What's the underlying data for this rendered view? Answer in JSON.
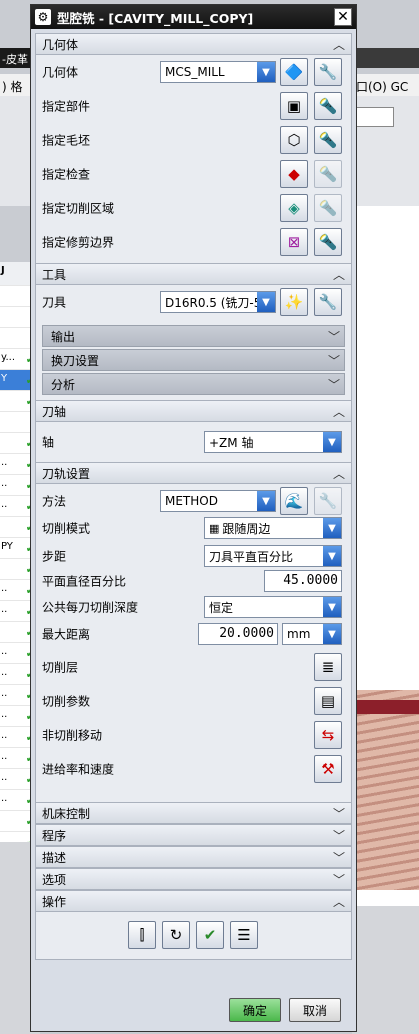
{
  "background": {
    "title_fragment": "-皮革",
    "menu_left": ") 格",
    "menu_right": "口(O)  GC",
    "nav_rows": [
      {
        "text": "",
        "check": false,
        "selected": false
      },
      {
        "text": "",
        "check": false,
        "selected": false
      },
      {
        "text": "",
        "check": false,
        "selected": false
      },
      {
        "text": "y...",
        "check": true,
        "selected": false
      },
      {
        "text": "Y",
        "check": true,
        "selected": true
      },
      {
        "text": "",
        "check": true,
        "selected": false
      },
      {
        "text": "",
        "check": false,
        "selected": false
      },
      {
        "text": "",
        "check": true,
        "selected": false
      },
      {
        "text": "..",
        "check": true,
        "selected": false
      },
      {
        "text": "..",
        "check": true,
        "selected": false
      },
      {
        "text": "..",
        "check": true,
        "selected": false
      },
      {
        "text": "",
        "check": true,
        "selected": false
      },
      {
        "text": "PY",
        "check": true,
        "selected": false
      },
      {
        "text": "",
        "check": true,
        "selected": false
      },
      {
        "text": "..",
        "check": true,
        "selected": false
      },
      {
        "text": "..",
        "check": true,
        "selected": false
      },
      {
        "text": "",
        "check": true,
        "selected": false
      },
      {
        "text": "..",
        "check": true,
        "selected": false
      },
      {
        "text": "..",
        "check": true,
        "selected": false
      },
      {
        "text": "..",
        "check": true,
        "selected": false
      },
      {
        "text": "..",
        "check": true,
        "selected": false
      },
      {
        "text": "..",
        "check": true,
        "selected": false
      },
      {
        "text": "..",
        "check": true,
        "selected": false
      },
      {
        "text": "..",
        "check": true,
        "selected": false
      },
      {
        "text": "..",
        "check": true,
        "selected": false
      },
      {
        "text": "",
        "check": true,
        "selected": false
      },
      {
        "text": "",
        "check": true,
        "selected": false
      }
    ],
    "header_col": "J"
  },
  "dialog": {
    "title": "型腔铣 - [CAVITY_MILL_COPY]",
    "gear_icon": "gear-icon",
    "close_icon": "close-icon"
  },
  "geometry": {
    "header": "几何体",
    "geometry_label": "几何体",
    "geometry_value": "MCS_MILL",
    "part_label": "指定部件",
    "blank_label": "指定毛坯",
    "check_label": "指定检查",
    "cut_area_label": "指定切削区域",
    "trim_label": "指定修剪边界"
  },
  "tool": {
    "header": "工具",
    "tool_label": "刀具",
    "tool_value": "D16R0.5 (铣刀-5",
    "output": "输出",
    "tool_change": "换刀设置",
    "analysis": "分析"
  },
  "axis": {
    "header": "刀轴",
    "axis_label": "轴",
    "axis_value": "+ZM 轴"
  },
  "path": {
    "header": "刀轨设置",
    "method_label": "方法",
    "method_value": "METHOD",
    "cut_pattern_label": "切削模式",
    "cut_pattern_value": "跟随周边",
    "stepover_label": "步距",
    "stepover_value": "刀具平直百分比",
    "percent_label": "平面直径百分比",
    "percent_value": "45.0000",
    "depth_label": "公共每刀切削深度",
    "depth_value": "恒定",
    "max_dist_label": "最大距离",
    "max_dist_value": "20.0000",
    "max_dist_unit": "mm",
    "cut_levels_label": "切削层",
    "cut_params_label": "切削参数",
    "non_cut_label": "非切削移动",
    "feeds_label": "进给率和速度"
  },
  "collapsed": {
    "machine": "机床控制",
    "program": "程序",
    "description": "描述",
    "options": "选项",
    "actions": "操作"
  },
  "buttons": {
    "ok": "确定",
    "cancel": "取消"
  }
}
